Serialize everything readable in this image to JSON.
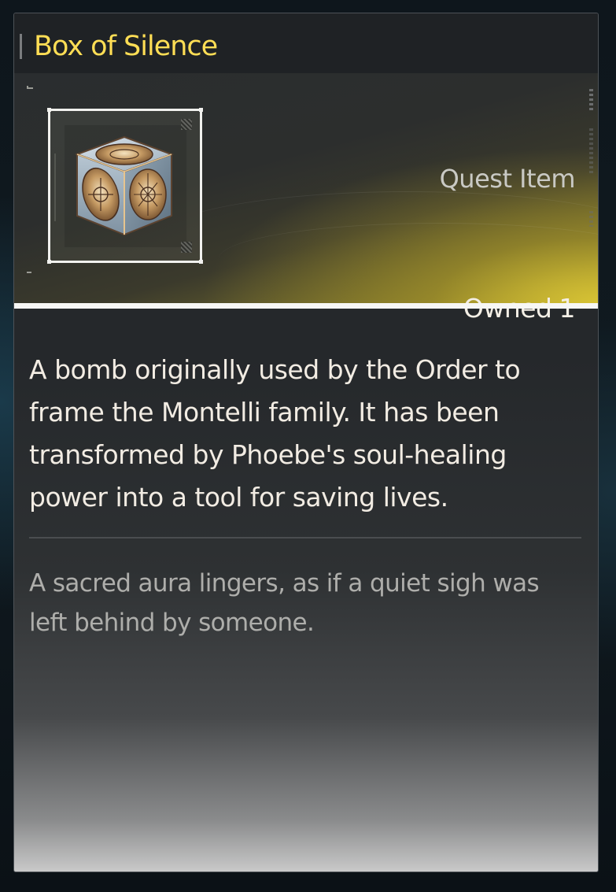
{
  "item": {
    "name": "Box of Silence",
    "category": "Quest Item",
    "owned_label": "Owned",
    "owned_count": "1",
    "description": "A bomb originally used by the Order to frame the Montelli family. It has been transformed by Phoebe's soul-healing power into a tool for saving lives.",
    "lore": "A sacred aura lingers, as if a quiet sigh was left behind by someone.",
    "icon": "ornate-cube-icon"
  },
  "colors": {
    "title": "#ffde55",
    "banner_accent": "#d6c234",
    "description_text": "#f2ece3",
    "lore_text": "#aeaeab"
  }
}
